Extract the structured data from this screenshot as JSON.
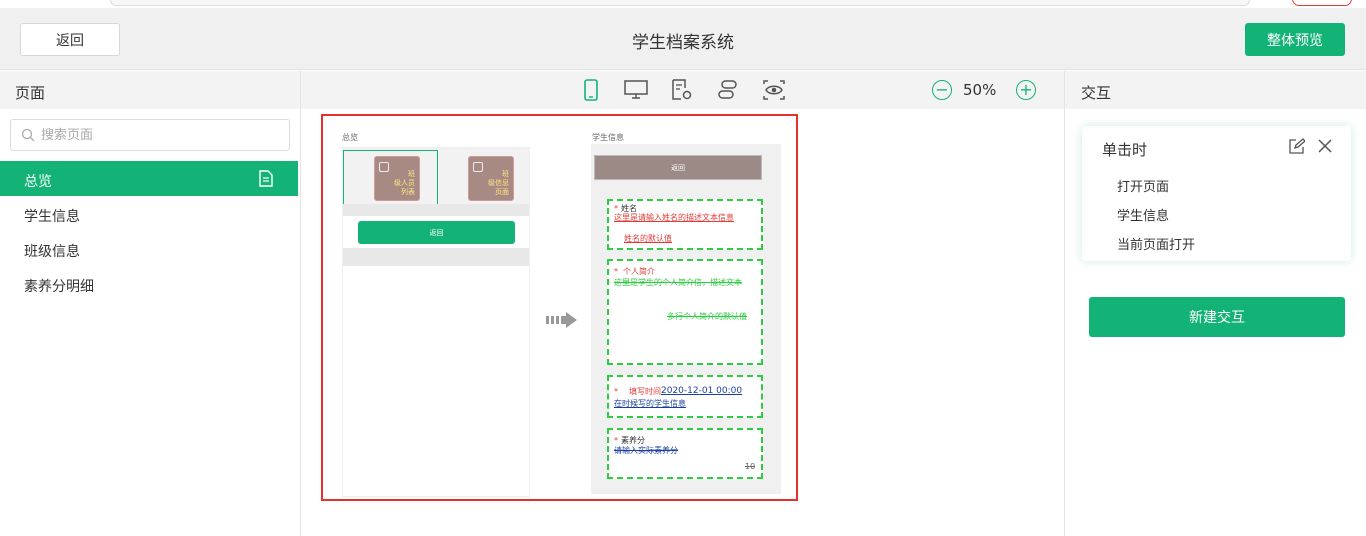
{
  "header": {
    "back_label": "返回",
    "title": "学生档案系统",
    "preview_label": "整体预览"
  },
  "left_panel": {
    "title": "页面",
    "search_placeholder": "搜索页面",
    "pages": [
      {
        "label": "总览",
        "active": true
      },
      {
        "label": "学生信息",
        "active": false
      },
      {
        "label": "班级信息",
        "active": false
      },
      {
        "label": "素养分明细",
        "active": false
      }
    ]
  },
  "toolbar": {
    "icons": [
      "mobile-icon",
      "desktop-icon",
      "page-settings-icon",
      "link-icon",
      "preview-eye-icon"
    ],
    "zoom_label": "50%"
  },
  "canvas": {
    "page_a": {
      "label": "总览",
      "tile1_text": "班\n级人员\n列表",
      "tile2_text": "班\n级信息\n页面",
      "button_label": "返回"
    },
    "page_b": {
      "label": "学生信息",
      "back_button_label": "返回",
      "name_field": {
        "label": "姓名",
        "desc": "这里是请输入姓名的描述文本信息",
        "default": "姓名的默认值"
      },
      "intro_field": {
        "label": "个人简介",
        "desc": "这里是学生的个人简介信，描述文本",
        "default": "多行个人简介的默认值"
      },
      "time_field": {
        "label": "填写时间",
        "value": "2020-12-01 00:00",
        "desc": "在时候写的学生信息"
      },
      "score_field": {
        "label": "素养分",
        "placeholder": "请输入实际素养分",
        "value": "10"
      }
    },
    "accent_color": "#13b378",
    "frame_color": "#e5302b"
  },
  "right_panel": {
    "title": "交互",
    "interaction": {
      "trigger": "单击时",
      "action": "打开页面",
      "target": "学生信息",
      "mode": "当前页面打开"
    },
    "new_button_label": "新建交互"
  }
}
